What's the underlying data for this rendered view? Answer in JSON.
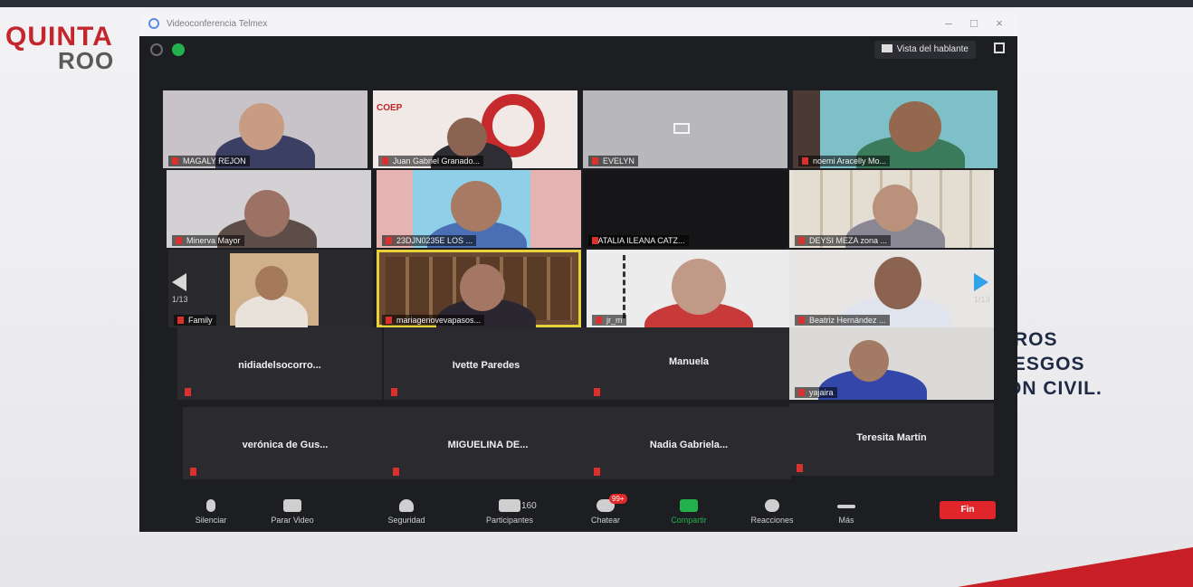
{
  "window": {
    "title": "Videoconferencia Telmex"
  },
  "background": {
    "logo_line1": "QUINTA",
    "logo_line2": "ROO",
    "slide_lines": [
      "ROS",
      "IESGOS",
      "ON CIVIL."
    ]
  },
  "meeting": {
    "view_button": "Vista del hablante",
    "page_left": "1/13",
    "page_right": "1/13"
  },
  "participants": [
    {
      "name": "MAGALY REJON",
      "video": true
    },
    {
      "name": "Juan Gabriel Granado...",
      "video": true
    },
    {
      "name": "EVELYN",
      "video": true
    },
    {
      "name": "noemi Aracelly Mo...",
      "video": true
    },
    {
      "name": "Minerva Mayor",
      "video": true
    },
    {
      "name": "23DJN0235E LOS ...",
      "video": true
    },
    {
      "name": "NATALIA ILEANA CATZ...",
      "video": false
    },
    {
      "name": "DEYSI MEZA zona ...",
      "video": true
    },
    {
      "name": "Family",
      "video": true
    },
    {
      "name": "mariagenovevapasos...",
      "video": true
    },
    {
      "name": "jr_m",
      "video": true
    },
    {
      "name": "Beatriz Hernández ...",
      "video": true
    },
    {
      "name": "nidiadelsocorro...",
      "video": false
    },
    {
      "name": "Ivette Paredes",
      "video": false
    },
    {
      "name": "Manuela",
      "video": false
    },
    {
      "name": "yajaira",
      "video": true
    },
    {
      "name": "verónica de Gus...",
      "video": false
    },
    {
      "name": "MIGUELINA DE...",
      "video": false
    },
    {
      "name": "Nadia Gabriela...",
      "video": false
    },
    {
      "name": "Teresita Martín",
      "video": false
    }
  ],
  "toolbar": {
    "mute": "Silenciar",
    "video": "Parar Video",
    "security": "Seguridad",
    "participants": "Participantes",
    "participants_count": "160",
    "chat": "Chatear",
    "chat_badge": "99+",
    "share": "Compartir",
    "reactions": "Reacciones",
    "more": "Más",
    "end": "Fin"
  },
  "colors": {
    "zoom_bg": "#1d1e22",
    "share_green": "#22b24c",
    "end_red": "#e0262a",
    "active_speaker": "#e7d23c"
  }
}
